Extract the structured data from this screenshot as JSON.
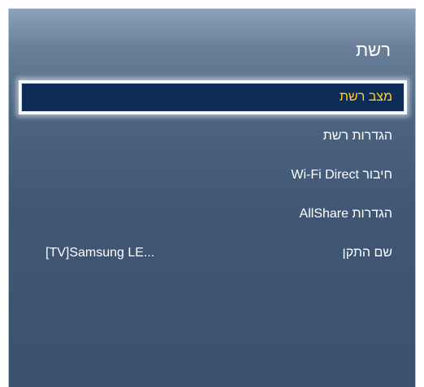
{
  "header": {
    "title": "רשת"
  },
  "menu": {
    "items": [
      {
        "label": "מצב רשת",
        "value": "",
        "selected": true
      },
      {
        "label": "הגדרות רשת",
        "value": "",
        "selected": false
      },
      {
        "label": "חיבור Wi-Fi Direct",
        "value": "",
        "selected": false
      },
      {
        "label": "הגדרות AllShare",
        "value": "",
        "selected": false
      },
      {
        "label": "שם התקן",
        "value": "[TV]Samsung LE...",
        "selected": false
      }
    ]
  },
  "colors": {
    "selected_text": "#ffd21f",
    "selected_background": "#0e2c57",
    "panel_background": "#4c6480",
    "text": "#ffffff"
  }
}
